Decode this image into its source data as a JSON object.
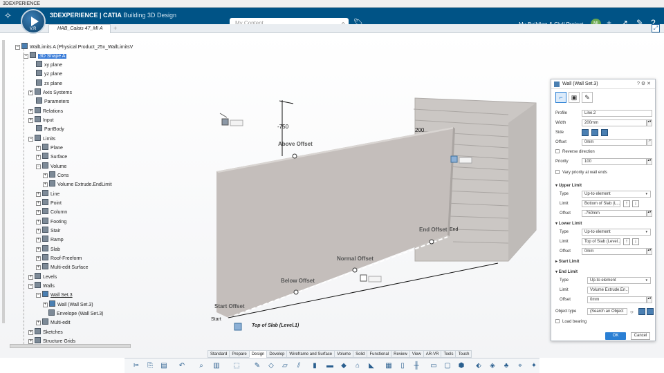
{
  "window": {
    "title": "3DEXPERIENCE"
  },
  "topbar": {
    "brand_prefix": "3DEXPERIENCE",
    "brand_app": "| CATIA",
    "brand_role": "Building 3D Design",
    "compass_version": "V.R",
    "search_placeholder": "My Content",
    "collab_space": "My Building & Civil Project",
    "avatar_initials": "MI"
  },
  "tabs": [
    {
      "label": "HAB_Calais 47_MI A"
    }
  ],
  "tree": {
    "root": "WallLimits A (Physical Product_25x_WallLimitsV",
    "items": [
      "3D Shape A",
      "xy plane",
      "yz plane",
      "zx plane",
      "Axis Systems",
      "Parameters",
      "Relations",
      "Input",
      "PartBody",
      "Limits",
      "Plane",
      "Surface",
      "Volume",
      "Cons",
      "Volume Extrude.EndLimit",
      "Line",
      "Point",
      "Column",
      "Footing",
      "Stair",
      "Ramp",
      "Slab",
      "Roof-Freeform",
      "Multi-edit Surface",
      "Levels",
      "Walls",
      "Wall Set.3",
      "Wall (Wall Set.3)",
      "Envelope (Wall Set.3)",
      "Multi-edit",
      "Sketches",
      "Structure Grids"
    ]
  },
  "viewport": {
    "dim_750": "-750",
    "dim_200": "200",
    "above_offset": "Above Offset",
    "normal_offset": "Normal Offset",
    "below_offset": "Below Offset",
    "start_offset": "Start Offset",
    "end_offset": "End Offset",
    "end_label": "End",
    "start_label": "Start",
    "slab_tag": "Top of Slab (Level.1)"
  },
  "panel": {
    "title": "Wall (Wall Set.3)",
    "profile_label": "Profile",
    "profile_value": "Line.2",
    "width_label": "Width",
    "width_value": "200mm",
    "side_label": "Side",
    "offset_label": "Offset",
    "offset_value": "0mm",
    "reverse_direction": "Reverse direction",
    "priority_label": "Priority",
    "priority_value": "100",
    "vary_priority": "Vary priority at wall ends",
    "upper_limit": "Upper Limit",
    "upper_type_label": "Type",
    "upper_type_value": "Up-to element",
    "upper_limit_label": "Limit",
    "upper_limit_value": "Bottom of Slab (L...",
    "upper_offset_label": "Offset",
    "upper_offset_value": "-750mm",
    "lower_limit": "Lower Limit",
    "lower_type_label": "Type",
    "lower_type_value": "Up-to element",
    "lower_limit_label": "Limit",
    "lower_limit_value": "Top of Slab (Level...",
    "lower_offset_label": "Offset",
    "lower_offset_value": "0mm",
    "start_limit": "Start Limit",
    "end_limit": "End Limit",
    "end_type_label": "Type",
    "end_type_value": "Up-to element",
    "end_limit_label": "Limit",
    "end_limit_value": "Volume Extrude.En...",
    "end_offset_label": "Offset",
    "end_offset_value": "0mm",
    "object_type_label": "Object type",
    "object_type_value": "(Search an Object",
    "load_bearing": "Load bearing",
    "ok": "OK",
    "cancel": "Cancel"
  },
  "action_tabs": [
    "Standard",
    "Prepare",
    "Design",
    "Develop",
    "Wireframe and Surface",
    "Volume",
    "Solid",
    "Functional",
    "Review",
    "View",
    "AR-VR",
    "Tools",
    "Touch"
  ],
  "active_tab": "Design"
}
